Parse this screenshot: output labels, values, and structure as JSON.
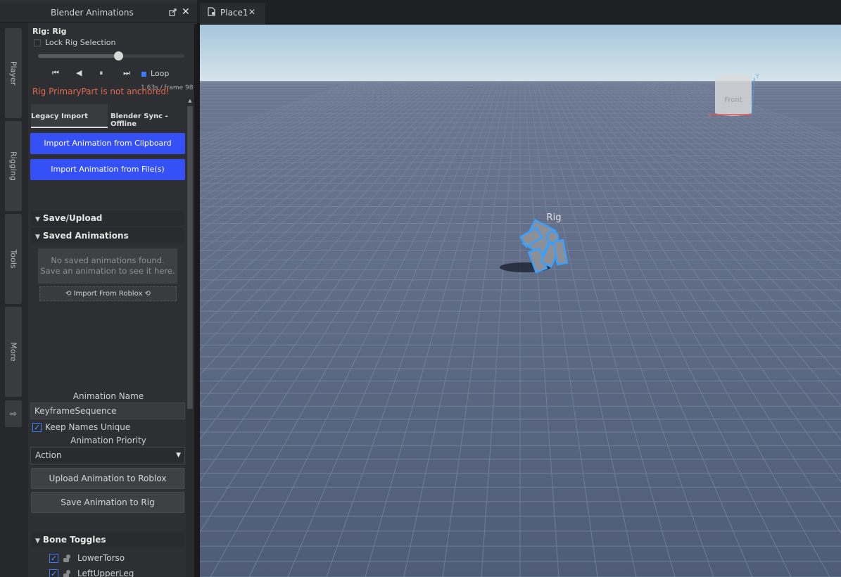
{
  "panel": {
    "title": "Blender Animations",
    "popout_icon": "popout-icon",
    "close_icon": "close-icon"
  },
  "sidebar_tabs": [
    "Player",
    "Rigging",
    "Tools",
    "More"
  ],
  "sidebar_arrow": "⇨",
  "player": {
    "rig_title": "Rig: Rig",
    "lock_label": "Lock Rig Selection",
    "slider_progress": 0.55,
    "buttons": {
      "first": "⏮",
      "back": "◀",
      "pause": "⏸",
      "last": "⏭"
    },
    "loop_label": "Loop",
    "frame_info": "1.63s / frame 98",
    "warning": "Rig PrimaryPart is not anchored!"
  },
  "tabs": [
    "Legacy Import",
    "Blender Sync - Offline"
  ],
  "import": {
    "clipboard": "Import Animation from Clipboard",
    "files": "Import Animation from File(s)"
  },
  "sections": {
    "save_upload": "Save/Upload",
    "saved_animations": "Saved Animations",
    "empty_line1": "No saved animations found.",
    "empty_line2": "Save an animation to see it here.",
    "import_roblox": "⟲ Import From Roblox ⟲"
  },
  "form": {
    "name_label": "Animation Name",
    "name_value": "KeyframeSequence",
    "keep_unique": "Keep Names Unique",
    "priority_label": "Animation Priority",
    "priority_value": "Action",
    "upload_button": "Upload Animation to Roblox",
    "save_button": "Save Animation to Rig"
  },
  "bones": {
    "title": "Bone Toggles",
    "items": [
      "LowerTorso",
      "LeftUpperLeg"
    ]
  },
  "document": {
    "tab_name": "Place1"
  },
  "viewport": {
    "rig_label": "Rig",
    "gizmo_label": "Front",
    "gizmo_axis_y": "Y",
    "gizmo_axis_x": "X"
  },
  "colors": {
    "accent_blue": "#3550f5",
    "warning": "#e06a4e",
    "selection": "#3aa0ff",
    "sky": "#b8d3e2",
    "ground": "#5c6a85"
  }
}
